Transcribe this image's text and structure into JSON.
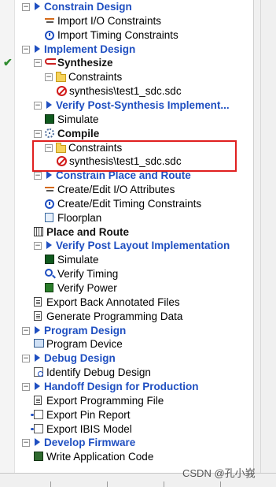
{
  "tree": [
    {
      "label": "Constrain Design",
      "style": "blue",
      "exp": "-",
      "tri": true,
      "indent": 1,
      "icon": null
    },
    {
      "label": "Import I/O Constraints",
      "style": "",
      "exp": null,
      "tri": false,
      "indent": 3,
      "icon": "io-edit-icon"
    },
    {
      "label": "Import Timing Constraints",
      "style": "",
      "exp": null,
      "tri": false,
      "indent": 3,
      "icon": "stopwatch-icon"
    },
    {
      "label": "Implement Design",
      "style": "blue",
      "exp": "-",
      "tri": true,
      "indent": 1,
      "icon": null
    },
    {
      "label": "Synthesize",
      "style": "bold",
      "exp": "-",
      "tri": false,
      "indent": 2,
      "icon": "synthesize-icon",
      "check": true
    },
    {
      "label": "Constraints",
      "style": "",
      "exp": "-",
      "tri": false,
      "indent": 3,
      "icon": "folder-icon"
    },
    {
      "label": "synthesis\\test1_sdc.sdc",
      "style": "",
      "exp": null,
      "tri": false,
      "indent": 4,
      "icon": "no-sign-icon"
    },
    {
      "label": "Verify Post-Synthesis Implement...",
      "style": "blue",
      "exp": "-",
      "tri": true,
      "indent": 2,
      "icon": null
    },
    {
      "label": "Simulate",
      "style": "",
      "exp": null,
      "tri": false,
      "indent": 3,
      "icon": "chip-icon"
    },
    {
      "label": "Compile",
      "style": "bold",
      "exp": "-",
      "tri": false,
      "indent": 2,
      "icon": "gear-icon"
    },
    {
      "label": "Constraints",
      "style": "",
      "exp": "-",
      "tri": false,
      "indent": 3,
      "icon": "folder-icon"
    },
    {
      "label": "synthesis\\test1_sdc.sdc",
      "style": "",
      "exp": null,
      "tri": false,
      "indent": 4,
      "icon": "no-sign-icon"
    },
    {
      "label": "Constrain Place and Route",
      "style": "blue",
      "exp": "-",
      "tri": true,
      "indent": 2,
      "icon": null
    },
    {
      "label": "Create/Edit I/O Attributes",
      "style": "",
      "exp": null,
      "tri": false,
      "indent": 3,
      "icon": "io-edit-icon"
    },
    {
      "label": "Create/Edit Timing Constraints",
      "style": "",
      "exp": null,
      "tri": false,
      "indent": 3,
      "icon": "stopwatch-icon"
    },
    {
      "label": "Floorplan",
      "style": "",
      "exp": null,
      "tri": false,
      "indent": 3,
      "icon": "floorplan-icon"
    },
    {
      "label": "Place and Route",
      "style": "bold",
      "exp": null,
      "tri": false,
      "indent": 2,
      "icon": "grid-icon"
    },
    {
      "label": "Verify Post Layout Implementation",
      "style": "blue",
      "exp": "-",
      "tri": true,
      "indent": 2,
      "icon": null
    },
    {
      "label": "Simulate",
      "style": "",
      "exp": null,
      "tri": false,
      "indent": 3,
      "icon": "chip-icon"
    },
    {
      "label": "Verify Timing",
      "style": "",
      "exp": null,
      "tri": false,
      "indent": 3,
      "icon": "search-icon"
    },
    {
      "label": "Verify Power",
      "style": "",
      "exp": null,
      "tri": false,
      "indent": 3,
      "icon": "power-icon"
    },
    {
      "label": "Export Back Annotated Files",
      "style": "",
      "exp": null,
      "tri": false,
      "indent": 2,
      "icon": "document-icon"
    },
    {
      "label": "Generate Programming Data",
      "style": "",
      "exp": null,
      "tri": false,
      "indent": 2,
      "icon": "document-icon"
    },
    {
      "label": "Program Design",
      "style": "blue",
      "exp": "-",
      "tri": true,
      "indent": 1,
      "icon": null
    },
    {
      "label": "Program Device",
      "style": "",
      "exp": null,
      "tri": false,
      "indent": 2,
      "icon": "program-device-icon"
    },
    {
      "label": "Debug Design",
      "style": "blue",
      "exp": "-",
      "tri": true,
      "indent": 1,
      "icon": null
    },
    {
      "label": "Identify Debug Design",
      "style": "",
      "exp": null,
      "tri": false,
      "indent": 2,
      "icon": "identify-icon"
    },
    {
      "label": "Handoff Design for Production",
      "style": "blue",
      "exp": "-",
      "tri": true,
      "indent": 1,
      "icon": null
    },
    {
      "label": "Export Programming File",
      "style": "",
      "exp": null,
      "tri": false,
      "indent": 2,
      "icon": "document-icon"
    },
    {
      "label": "Export Pin Report",
      "style": "",
      "exp": null,
      "tri": false,
      "indent": 2,
      "icon": "export-icon"
    },
    {
      "label": "Export IBIS Model",
      "style": "",
      "exp": null,
      "tri": false,
      "indent": 2,
      "icon": "export-icon"
    },
    {
      "label": "Develop Firmware",
      "style": "blue",
      "exp": "-",
      "tri": true,
      "indent": 1,
      "icon": null
    },
    {
      "label": "Write Application Code",
      "style": "",
      "exp": null,
      "tri": false,
      "indent": 2,
      "icon": "write-code-icon"
    }
  ],
  "check_mark": "✔",
  "watermark": "CSDN @孔小峩"
}
